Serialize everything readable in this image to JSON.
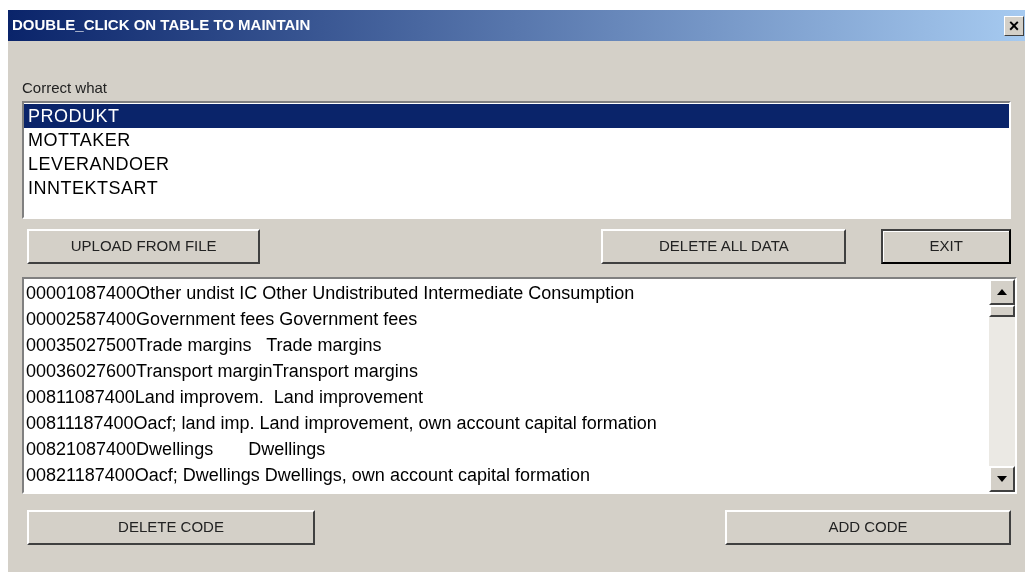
{
  "window": {
    "title": "DOUBLE_CLICK ON TABLE TO MAINTAIN",
    "close": "×"
  },
  "selector": {
    "label": "Correct what",
    "items": [
      {
        "text": "PRODUKT",
        "selected": true
      },
      {
        "text": "MOTTAKER",
        "selected": false
      },
      {
        "text": "LEVERANDOER",
        "selected": false
      },
      {
        "text": "INNTEKTSART",
        "selected": false
      }
    ]
  },
  "top_buttons": [
    {
      "label": "UPLOAD FROM FILE",
      "kind": "normal"
    },
    {
      "label": "DELETE ALL DATA",
      "kind": "normal"
    },
    {
      "label": "EXIT",
      "kind": "default"
    }
  ],
  "codes": [
    "00001087400Other undist IC Other Undistributed Intermediate Consumption",
    "00002587400Government fees Government fees",
    "00035027500Trade margins   Trade margins",
    "00036027600Transport marginTransport margins",
    "00811087400Land improvem.  Land improvement",
    "00811187400Oacf; land imp. Land improvement, own account capital formation",
    "00821087400Dwellings       Dwellings",
    "00821187400Oacf; Dwellings Dwellings, own account capital formation"
  ],
  "bottom_buttons": [
    {
      "label": "DELETE CODE"
    },
    {
      "label": "ADD CODE"
    }
  ]
}
